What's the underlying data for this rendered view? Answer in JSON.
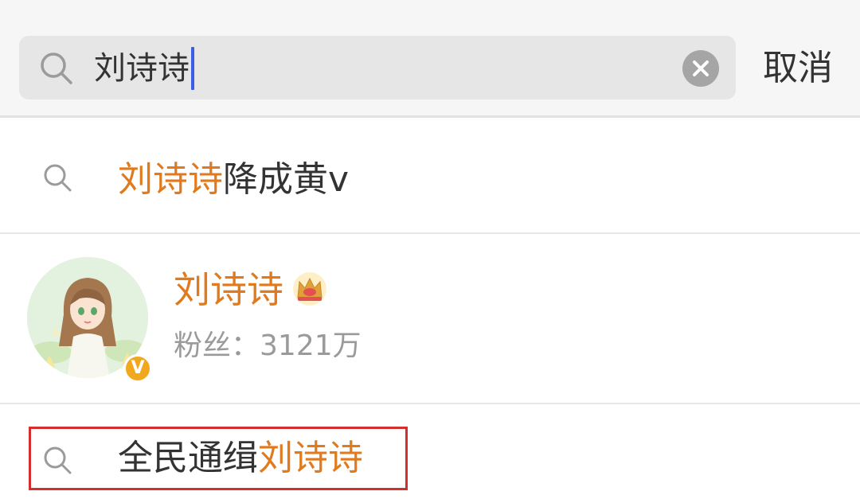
{
  "search": {
    "query": "刘诗诗",
    "cancel_label": "取消"
  },
  "suggestions": [
    {
      "highlight": "刘诗诗",
      "rest": "降成黄v"
    },
    {
      "prefix": "全民通缉",
      "highlight": "刘诗诗"
    }
  ],
  "user": {
    "name": "刘诗诗",
    "fans_label": "粉丝：",
    "fans_count": "3121万",
    "verified_mark": "V"
  },
  "colors": {
    "highlight": "#e07a1c",
    "caret": "#3a5ee8",
    "annotation_box": "#d32f2f",
    "verified_badge": "#f2a81d"
  },
  "icons": [
    "search-icon",
    "clear-icon",
    "crown-icon",
    "verified-badge"
  ]
}
